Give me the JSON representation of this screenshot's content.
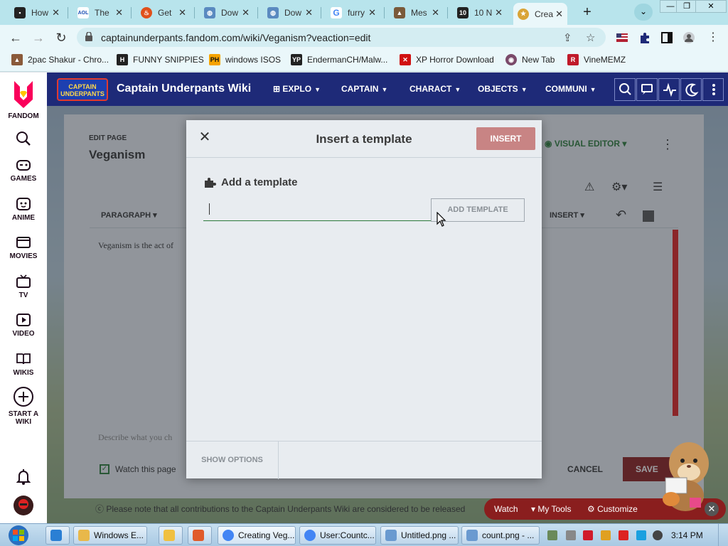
{
  "browser": {
    "tabs": [
      {
        "label": "How",
        "favicon": "film-icon",
        "color": "#222222"
      },
      {
        "label": "The",
        "favicon": "aol-icon",
        "color": "#1a4fb4"
      },
      {
        "label": "Get",
        "favicon": "fire-icon",
        "color": "#e0501a"
      },
      {
        "label": "Dow",
        "favicon": "globe-icon",
        "color": "#5a8ac0"
      },
      {
        "label": "Dow",
        "favicon": "globe-icon",
        "color": "#5a8ac0"
      },
      {
        "label": "furry",
        "favicon": "google-icon",
        "color": "#4285f4"
      },
      {
        "label": "Mes",
        "favicon": "map-icon",
        "color": "#7a5a3a"
      },
      {
        "label": "10 N",
        "favicon": "ten-icon",
        "color": "#222222"
      },
      {
        "label": "Crea",
        "favicon": "captain-icon",
        "color": "#d9a437"
      }
    ],
    "active_tab": 8,
    "url": "captainunderpants.fandom.com/wiki/Veganism?veaction=edit",
    "bookmarks": [
      {
        "label": "2pac Shakur - Chro...",
        "icon": "person-icon",
        "color": "#8a5a3a"
      },
      {
        "label": "FUNNY SNIPPIES",
        "icon": "h-icon",
        "color": "#222222"
      },
      {
        "label": "windows ISOS",
        "icon": "ph-icon",
        "color": "#f5a300"
      },
      {
        "label": "EndermanCH/Malw...",
        "icon": "yp-icon",
        "color": "#222222"
      },
      {
        "label": "XP Horror Download",
        "icon": "x-icon",
        "color": "#d01010"
      },
      {
        "label": "New Tab",
        "icon": "newtab-icon",
        "color": "#7a4a6a"
      },
      {
        "label": "VineMEMZ",
        "icon": "r-icon",
        "color": "#c01a2a"
      }
    ]
  },
  "fandom_rail": {
    "brand": "FANDOM",
    "items": [
      {
        "label": "GAMES",
        "icon": "gamepad-icon"
      },
      {
        "label": "ANIME",
        "icon": "anime-icon"
      },
      {
        "label": "MOVIES",
        "icon": "movies-icon"
      },
      {
        "label": "TV",
        "icon": "tv-icon"
      },
      {
        "label": "VIDEO",
        "icon": "video-icon"
      },
      {
        "label": "WIKIS",
        "icon": "book-icon"
      }
    ],
    "start_wiki_line1": "START A",
    "start_wiki_line2": "WIKI"
  },
  "wiki": {
    "name": "Captain Underpants Wiki",
    "logo_line1": "CAPTAIN",
    "logo_line2": "UNDERPANTS",
    "nav": [
      "EXPLO",
      "CAPTAIN",
      "CHARACT",
      "OBJECTS",
      "COMMUNI"
    ]
  },
  "editor": {
    "edit_page_label": "EDIT PAGE",
    "page_title": "Veganism",
    "visual_editor": "VISUAL EDITOR",
    "paragraph": "PARAGRAPH",
    "insert": "INSERT",
    "content_snippet": "Veganism is the act of",
    "summary_placeholder": "Describe what you ch",
    "watch_label": "Watch this page",
    "cancel": "CANCEL",
    "save": "SAVE",
    "notice": "Please note that all contributions to the Captain Underpants Wiki are considered to be released"
  },
  "modal": {
    "title": "Insert a template",
    "insert_button": "INSERT",
    "add_heading": "Add a template",
    "input_value": "",
    "add_template_button": "ADD TEMPLATE",
    "show_options": "SHOW OPTIONS"
  },
  "mascot_bar": {
    "watch": "Watch",
    "my_tools": "My Tools",
    "customize": "Customize"
  },
  "taskbar": {
    "buttons": [
      {
        "label": "Windows E...",
        "color": "#e8b84a"
      },
      {
        "label": "",
        "color": "#f0c040"
      },
      {
        "label": "",
        "color": "#e05a2a"
      },
      {
        "label": "Creating Veg...",
        "color": "#4285f4"
      },
      {
        "label": "User:Countc...",
        "color": "#4285f4"
      },
      {
        "label": "Untitled.png ...",
        "color": "#6a9ad0"
      },
      {
        "label": "count.png - ...",
        "color": "#6a9ad0"
      }
    ],
    "clock": "3:14 PM"
  }
}
